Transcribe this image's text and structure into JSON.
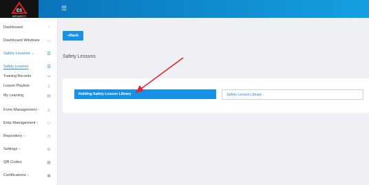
{
  "header": {
    "logo_text": "INFOAFETY",
    "menu_icon": "hamburger-icon"
  },
  "sidebar": {
    "items": [
      {
        "label": "Dashboard",
        "icon": "gauge-icon"
      },
      {
        "label": "Dashboard Windows",
        "icon": "window-icon"
      },
      {
        "label": "Safety Lessons",
        "icon": "list-icon",
        "expanded": true
      },
      {
        "label": "Safety Lessons",
        "icon": "list-icon"
      },
      {
        "label": "Training Records",
        "icon": "records-icon"
      },
      {
        "label": "Lesson Playlists",
        "icon": "playlist-icon"
      },
      {
        "label": "My Learning",
        "icon": "book-icon"
      },
      {
        "label": "Form Management",
        "icon": "user-icon"
      },
      {
        "label": "Emp Management",
        "icon": "group-icon"
      },
      {
        "label": "Repository",
        "icon": "clock-icon"
      },
      {
        "label": "Settings",
        "icon": "gear-icon"
      },
      {
        "label": "QR Codes",
        "icon": "qr-icon"
      },
      {
        "label": "Certifications",
        "icon": "certificate-icon"
      }
    ]
  },
  "main": {
    "back_label": "Back",
    "page_title": "Safety Lessons",
    "primary_button": "Holding Safety Lesson Library",
    "secondary_button": "Safety Lesson Library"
  },
  "colors": {
    "accent": "#1791e6",
    "topbar": "#0a6fb8",
    "annotation": "#e8212a"
  }
}
